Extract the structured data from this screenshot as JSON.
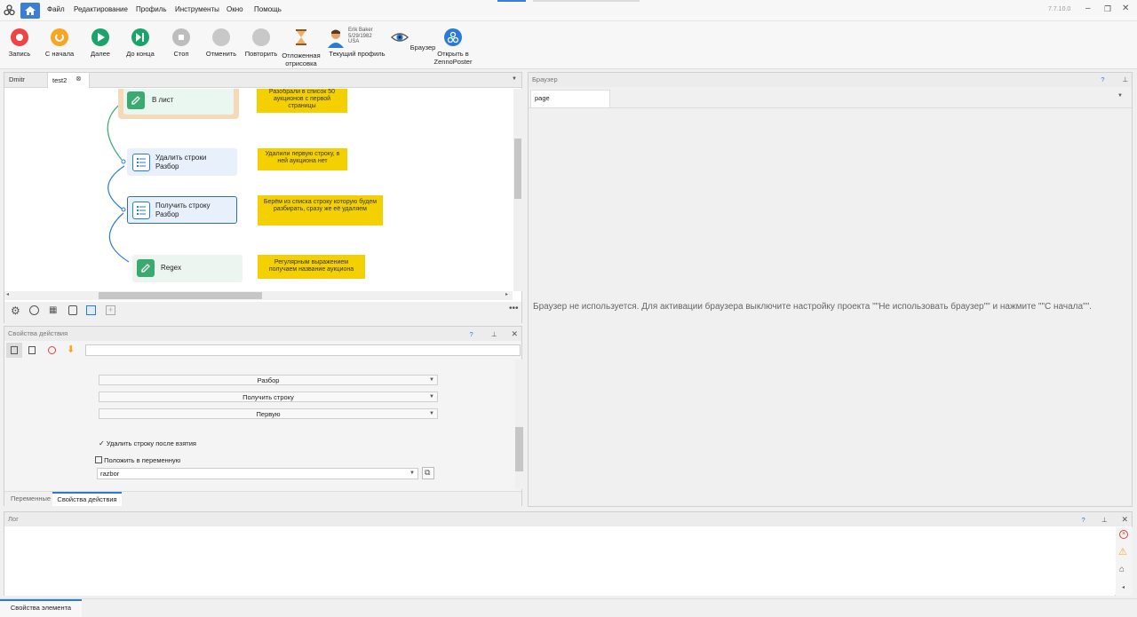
{
  "menu": [
    "Файл",
    "Редактирование",
    "Профиль",
    "Инструменты",
    "Окно",
    "Помощь"
  ],
  "version": "7.7.10.0",
  "toolbar": {
    "record": "Запись",
    "from_start": "С начала",
    "next": "Далее",
    "to_end": "До конца",
    "stop": "Стоп",
    "undo": "Отменить",
    "redo": "Повторить",
    "deferred": "Отложенная отрисовка",
    "profile_line1": "Erik Baker",
    "profile_line2": "5/29/1982",
    "profile_line3": "USA",
    "current_profile": "Текущий профиль",
    "browser": "Браузер",
    "open_in_zp": "Открыть в ZennoPoster"
  },
  "editor": {
    "tabs": [
      "Dmitr",
      "test2"
    ],
    "nodes": [
      {
        "label": "В лист"
      },
      {
        "label": "Удалить строки\nРазбор"
      },
      {
        "label": "Получить строку\nРазбор"
      },
      {
        "label": "Regex"
      }
    ],
    "notes": [
      "Разобрали в список 50 аукционов с первой страницы",
      "Удалили первую строку, в ней аукциона нет",
      "Берём из списка строку которую будем разбирать, сразу же её удаляем",
      "Регулярным выражением получаем название аукциона"
    ]
  },
  "action_props": {
    "title": "Свойства действия",
    "help": "?",
    "list_select": "Разбор",
    "op_select": "Получить строку",
    "which_select": "Первую",
    "delete_after": "Удалить строку после взятия",
    "save_to_var": "Положить в переменную",
    "var_value": "razbor",
    "bottom_tabs": [
      "Переменные",
      "Свойства действия"
    ]
  },
  "browser_pane": {
    "title": "Браузер",
    "help": "?",
    "tab": "page",
    "message": "Браузер не используется. Для активации браузера выключите настройку проекта \"\"Не использовать браузер\"\" и нажмите \"\"С начала\"\"."
  },
  "log": {
    "title": "Лог",
    "help": "?"
  },
  "status": "Свойства элемента"
}
